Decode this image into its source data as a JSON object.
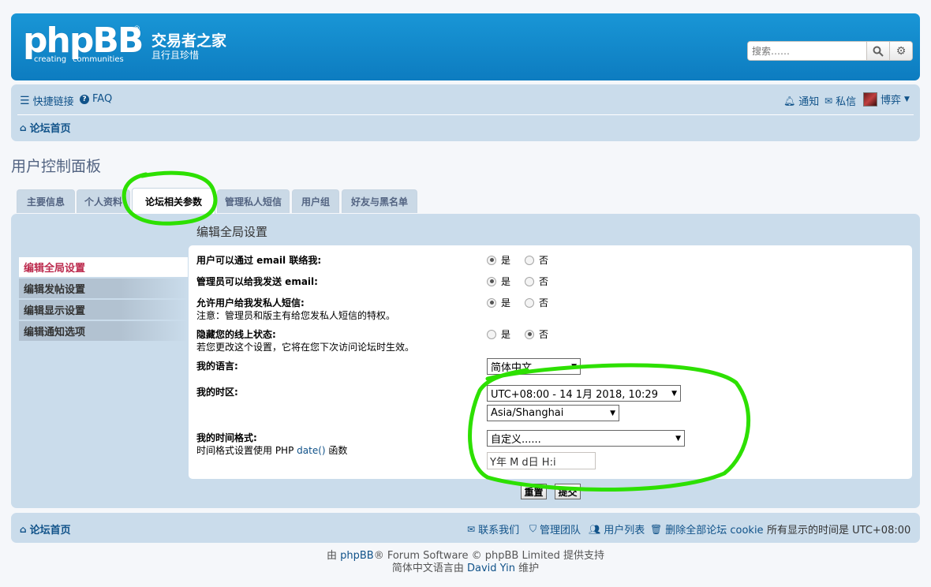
{
  "header": {
    "logo_text": "phpBB",
    "logo_reg": "®",
    "logo_sub_1": "creating",
    "logo_sub_2": "communities",
    "site_title": "交易者之家",
    "site_desc": "且行且珍惜",
    "search_placeholder": "搜索……",
    "search_icon": "search-icon",
    "advanced_icon": "gear-icon"
  },
  "navbar": {
    "quick_links": "快捷链接",
    "faq": "FAQ",
    "notifications": "通知",
    "private_messages": "私信",
    "username": "博弈",
    "board_index": "论坛首页"
  },
  "page_title": "用户控制面板",
  "tabs": [
    {
      "label": "主要信息"
    },
    {
      "label": "个人资料"
    },
    {
      "label": "论坛相关参数"
    },
    {
      "label": "管理私人短信"
    },
    {
      "label": "用户组"
    },
    {
      "label": "好友与黑名单"
    }
  ],
  "sidebar": {
    "items": [
      {
        "label": "编辑全局设置"
      },
      {
        "label": "编辑发帖设置"
      },
      {
        "label": "编辑显示设置"
      },
      {
        "label": "编辑通知选项"
      }
    ]
  },
  "form": {
    "heading": "编辑全局设置",
    "yes": "是",
    "no": "否",
    "allow_email_label": "用户可以通过 email 联络我:",
    "admin_email_label": "管理员可以给我发送 email:",
    "allow_pm_label": "允许用户给我发私人短信:",
    "allow_pm_note": "注意：管理员和版主有给您发私人短信的特权。",
    "hide_online_label": "隐藏您的线上状态:",
    "hide_online_note": "若您更改这个设置，它将在您下次访问论坛时生效。",
    "language_label": "我的语言:",
    "language_value": "简体中文",
    "timezone_label": "我的时区:",
    "timezone_value": "UTC+08:00 - 14 1月 2018, 10:29",
    "timezone_region": "Asia/Shanghai",
    "dateformat_label": "我的时间格式:",
    "dateformat_note_prefix": "时间格式设置使用 PHP",
    "dateformat_note_link": "date()",
    "dateformat_note_suffix": "函数",
    "dateformat_select": "自定义......",
    "dateformat_value": "Y年 M d日 H:i",
    "reset_button": "重置",
    "submit_button": "提交"
  },
  "footer": {
    "board_index": "论坛首页",
    "contact_us": "联系我们",
    "team": "管理团队",
    "members": "用户列表",
    "delete_cookies": "删除全部论坛 cookie",
    "timezone_note": "所有显示的时间是 UTC+08:00"
  },
  "copyright": {
    "line1_prefix": "由",
    "line1_link": "phpBB",
    "line1_suffix": "® Forum Software © phpBB Limited 提供支持",
    "line2_prefix": "简体中文语言由",
    "line2_link": "David Yin",
    "line2_suffix": "维护"
  },
  "colors": {
    "header_blue": "#0d7cc0",
    "nav_bg": "#cadceb",
    "link": "#105289",
    "active_side": "#bc2a4d",
    "highlight_green": "#2de000"
  }
}
